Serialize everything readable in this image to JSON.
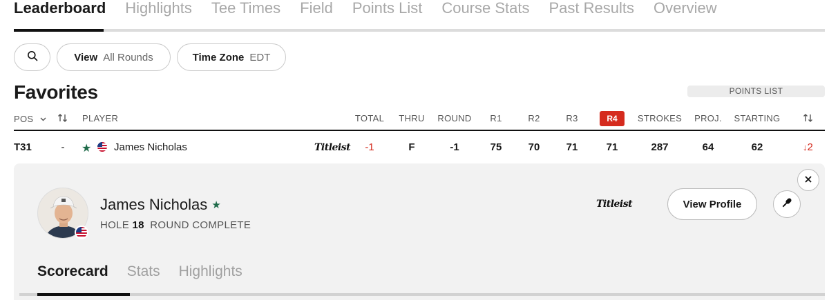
{
  "top_nav": {
    "tabs": [
      "Leaderboard",
      "Highlights",
      "Tee Times",
      "Field",
      "Points List",
      "Course Stats",
      "Past Results",
      "Overview"
    ]
  },
  "filters": {
    "search_icon": "search-icon",
    "view_label": "View",
    "view_value": "All Rounds",
    "timezone_label": "Time Zone",
    "timezone_value": "EDT"
  },
  "section": {
    "title": "Favorites",
    "points_list_label": "POINTS LIST"
  },
  "table": {
    "headers": {
      "pos": "POS",
      "player": "PLAYER",
      "total": "TOTAL",
      "thru": "THRU",
      "round": "ROUND",
      "r1": "R1",
      "r2": "R2",
      "r3": "R3",
      "r4": "R4",
      "strokes": "STROKES",
      "proj": "PROJ.",
      "starting": "STARTING"
    },
    "row": {
      "pos": "T31",
      "move": "-",
      "player": "James Nicholas",
      "sponsor": "Titleist",
      "total": "-1",
      "thru": "F",
      "round": "-1",
      "r1": "75",
      "r2": "70",
      "r3": "71",
      "r4": "71",
      "strokes": "287",
      "proj": "64",
      "starting": "62",
      "change": "2"
    }
  },
  "player_card": {
    "name": "James Nicholas",
    "hole_label": "HOLE",
    "hole_value": "18",
    "status": "ROUND COMPLETE",
    "sponsor": "Titleist",
    "view_profile": "View Profile",
    "tabs": [
      "Scorecard",
      "Stats",
      "Highlights"
    ]
  },
  "colors": {
    "accent_red": "#d52b1e",
    "favorite_star": "#1f6b4a",
    "card_bg": "#f2f2f2"
  }
}
